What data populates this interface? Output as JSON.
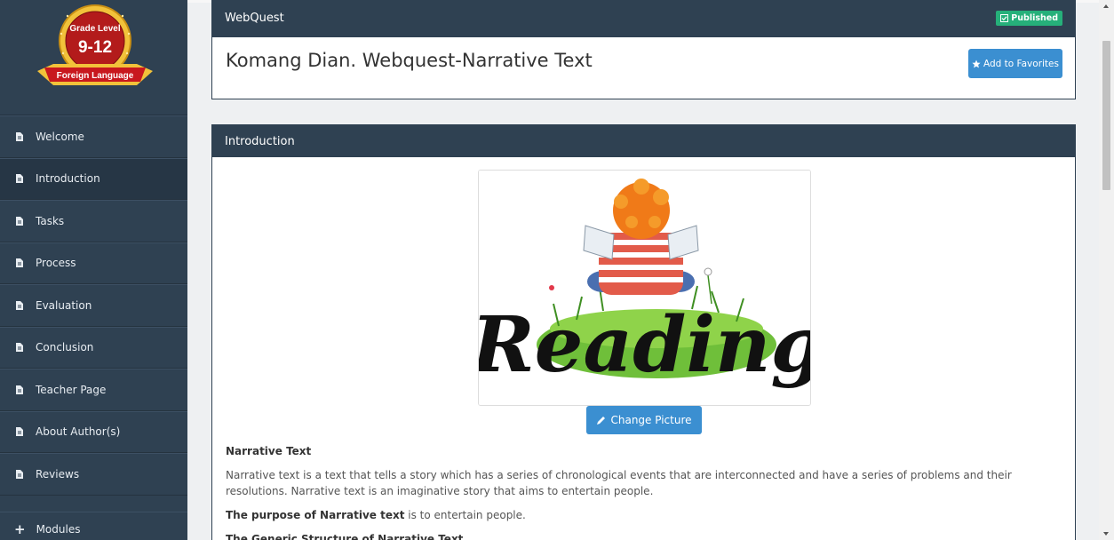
{
  "badge": {
    "line1": "Grade Level",
    "line2": "9-12",
    "line3": "Foreign Language"
  },
  "sidebar": {
    "items": [
      {
        "label": "Welcome",
        "active": false
      },
      {
        "label": "Introduction",
        "active": true
      },
      {
        "label": "Tasks",
        "active": false
      },
      {
        "label": "Process",
        "active": false
      },
      {
        "label": "Evaluation",
        "active": false
      },
      {
        "label": "Conclusion",
        "active": false
      },
      {
        "label": "Teacher Page",
        "active": false
      },
      {
        "label": "About Author(s)",
        "active": false
      },
      {
        "label": "Reviews",
        "active": false
      }
    ],
    "modules_label": "Modules"
  },
  "header": {
    "section": "WebQuest",
    "status": "Published",
    "title": "Komang Dian. Webquest-Narrative Text",
    "favorites_label": "Add to Favorites"
  },
  "intro": {
    "heading": "Introduction",
    "picture_word": "Reading",
    "change_picture_label": "Change Picture",
    "subheading": "Narrative Text",
    "paragraph": "Narrative text is a text that tells a story which has a series of chronological events that are interconnected and have a series of problems and their resolutions. Narrative text is an imaginative story that aims to entertain people.",
    "purpose_bold": "The purpose of Narrative text",
    "purpose_rest": " is to entertain people.",
    "structure_heading": "The Generic Structure of Narrative Text"
  },
  "colors": {
    "sidebar": "#2f4152",
    "accent_button": "#3b8fd1",
    "published": "#26b07a",
    "badge_red": "#b31b1b",
    "badge_gold": "#f2c23a"
  },
  "icons": {
    "nav": "document-icon",
    "modules": "plus-icon",
    "status": "check-square-icon",
    "favorites": "star-icon",
    "change": "pencil-icon"
  }
}
